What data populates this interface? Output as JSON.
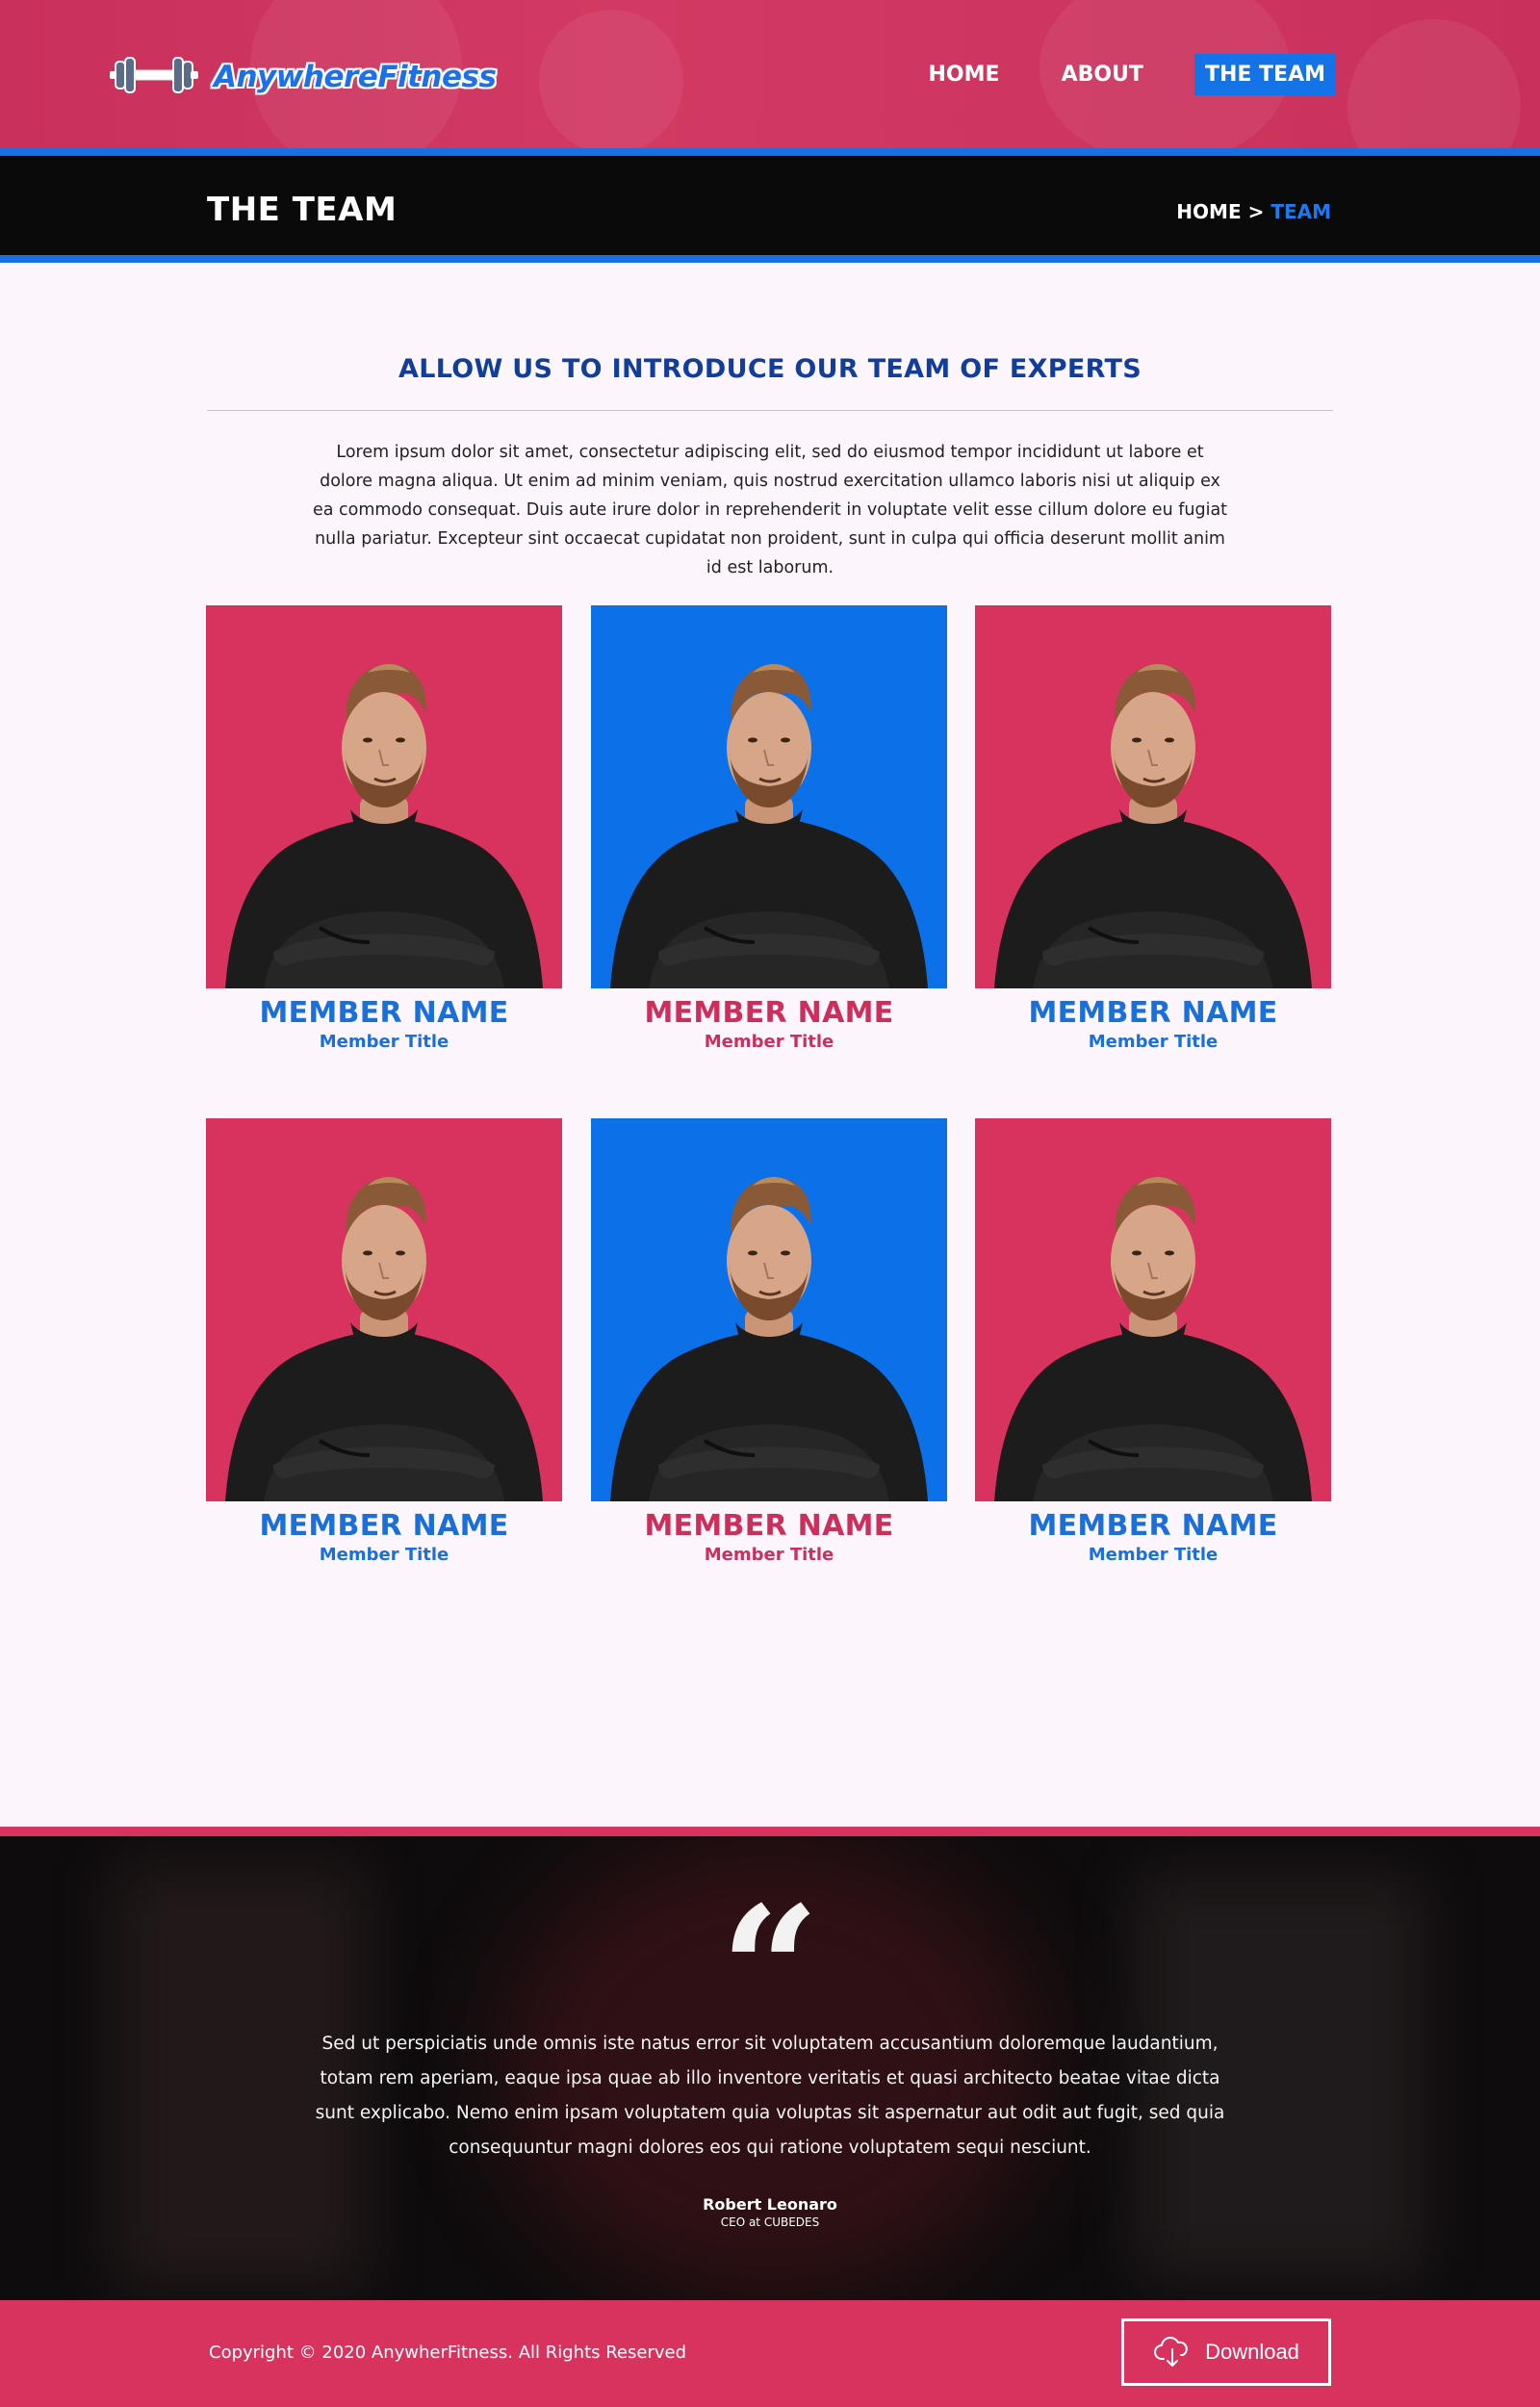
{
  "brand": {
    "name": "AnywhereFitness"
  },
  "nav": {
    "items": [
      {
        "label": "HOME",
        "active": false
      },
      {
        "label": "ABOUT",
        "active": false
      },
      {
        "label": "THE TEAM",
        "active": true
      }
    ]
  },
  "page": {
    "title": "THE TEAM"
  },
  "breadcrumb": {
    "home": "HOME",
    "separator": ">",
    "current": "TEAM"
  },
  "intro": {
    "title": "ALLOW US TO INTRODUCE OUR TEAM OF EXPERTS",
    "text": "Lorem ipsum dolor sit amet, consectetur adipiscing elit, sed do eiusmod tempor incididunt ut labore et dolore magna aliqua. Ut enim ad minim veniam, quis nostrud exercitation ullamco laboris nisi ut aliquip ex ea commodo consequat. Duis aute irure dolor in reprehenderit in voluptate velit esse cillum dolore eu fugiat nulla pariatur. Excepteur sint occaecat cupidatat non proident, sunt in culpa qui officia deserunt mollit anim id est laborum."
  },
  "team": {
    "members": [
      {
        "name": "MEMBER NAME",
        "title": "Member Title",
        "photo_bg": "#d8335e",
        "text_color": "#1a6fd8"
      },
      {
        "name": "MEMBER NAME",
        "title": "Member Title",
        "photo_bg": "#0c70e8",
        "text_color": "#cc2f5c"
      },
      {
        "name": "MEMBER NAME",
        "title": "Member Title",
        "photo_bg": "#d8335e",
        "text_color": "#1a6fd8"
      },
      {
        "name": "MEMBER NAME",
        "title": "Member Title",
        "photo_bg": "#d8335e",
        "text_color": "#1a6fd8"
      },
      {
        "name": "MEMBER NAME",
        "title": "Member Title",
        "photo_bg": "#0c70e8",
        "text_color": "#cc2f5c"
      },
      {
        "name": "MEMBER NAME",
        "title": "Member Title",
        "photo_bg": "#d8335e",
        "text_color": "#1a6fd8"
      }
    ]
  },
  "testimonial": {
    "quote_mark": "“",
    "text": "Sed ut perspiciatis unde omnis iste natus error sit voluptatem accusantium doloremque laudantium, totam rem aperiam, eaque ipsa quae ab illo inventore veritatis et quasi architecto beatae vitae dicta sunt explicabo. Nemo enim ipsam voluptatem quia voluptas sit aspernatur aut odit aut fugit, sed quia consequuntur magni dolores eos qui ratione voluptatem sequi nesciunt.",
    "author": "Robert Leonaro",
    "author_role": "CEO at CUBEDES"
  },
  "footer": {
    "copyright": "Copyright © 2020 AnywherFitness. All Rights Reserved",
    "download_label": "Download",
    "download_icon": "cloud-download-icon"
  },
  "colors": {
    "brand_pink": "#d8335e",
    "brand_blue": "#1a6fe3",
    "heading_navy": "#123e9b",
    "title_bar": "#0a0a0a"
  }
}
